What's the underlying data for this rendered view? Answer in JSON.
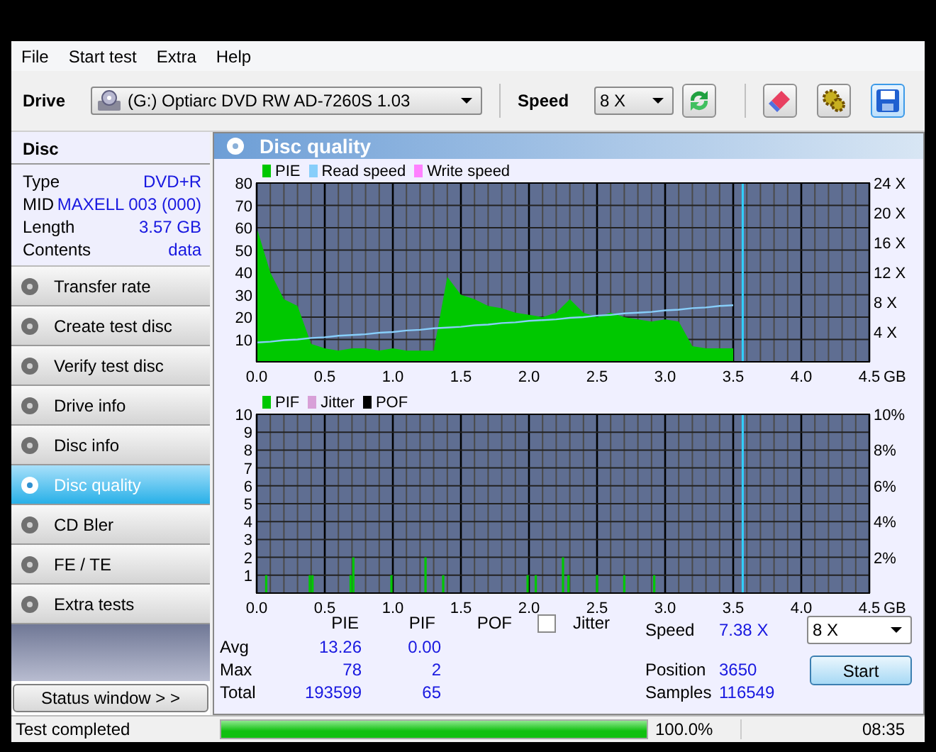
{
  "menu": [
    "File",
    "Start test",
    "Extra",
    "Help"
  ],
  "toolbar": {
    "drive_label": "Drive",
    "drive": "(G:)   Optiarc DVD RW AD-7260S 1.03",
    "speed_label": "Speed",
    "speed": "8 X"
  },
  "disc": {
    "title": "Disc",
    "fields": [
      {
        "label": "Type",
        "value": "DVD+R"
      },
      {
        "label": "MID",
        "value": "MAXELL 003 (000)"
      },
      {
        "label": "Length",
        "value": "3.57 GB"
      },
      {
        "label": "Contents",
        "value": "data"
      }
    ]
  },
  "nav": [
    {
      "label": "Transfer rate",
      "selected": false
    },
    {
      "label": "Create test disc",
      "selected": false
    },
    {
      "label": "Verify test disc",
      "selected": false
    },
    {
      "label": "Drive info",
      "selected": false
    },
    {
      "label": "Disc info",
      "selected": false
    },
    {
      "label": "Disc quality",
      "selected": true
    },
    {
      "label": "CD Bler",
      "selected": false
    },
    {
      "label": "FE / TE",
      "selected": false
    },
    {
      "label": "Extra tests",
      "selected": false
    }
  ],
  "status_window_button": "Status window > >",
  "panel_title": "Disc quality",
  "charts": [
    {
      "legend_extra": [
        {
          "label": "Write speed",
          "color": "#ff80ff"
        }
      ],
      "chart_data": {
        "type": "area",
        "xlabel": "GB",
        "xlim": [
          0,
          4.5
        ],
        "ylim": [
          0,
          80
        ],
        "y2lim": [
          0,
          24
        ],
        "grid": true,
        "x": [
          0.0,
          0.1,
          0.2,
          0.3,
          0.4,
          0.5,
          0.6,
          0.7,
          0.8,
          0.9,
          1.0,
          1.1,
          1.2,
          1.3,
          1.4,
          1.5,
          1.6,
          1.7,
          1.8,
          1.9,
          2.0,
          2.1,
          2.2,
          2.3,
          2.4,
          2.5,
          2.6,
          2.7,
          2.8,
          2.9,
          3.0,
          3.1,
          3.2,
          3.3,
          3.4,
          3.5
        ],
        "series": [
          {
            "name": "PIE",
            "color": "#00c800",
            "values": [
              60,
              40,
              28,
              25,
              8,
              6,
              5,
              6,
              6,
              5,
              6,
              5,
              5,
              5,
              38,
              30,
              28,
              25,
              24,
              22,
              21,
              20,
              22,
              28,
              22,
              20,
              22,
              20,
              19,
              18,
              19,
              18,
              7,
              6,
              6,
              6
            ]
          },
          {
            "name": "Read speed",
            "color": "#87cefa",
            "type": "line",
            "axis": "y2",
            "values": [
              2.6,
              2.7,
              2.9,
              3.0,
              3.2,
              3.3,
              3.5,
              3.6,
              3.7,
              3.9,
              4.0,
              4.2,
              4.3,
              4.5,
              4.6,
              4.7,
              4.9,
              5.0,
              5.2,
              5.3,
              5.5,
              5.6,
              5.7,
              5.9,
              6.0,
              6.2,
              6.3,
              6.5,
              6.6,
              6.7,
              6.9,
              7.0,
              7.2,
              7.3,
              7.5,
              7.6
            ]
          }
        ],
        "ref_lines": [
          {
            "axis": "x",
            "value": 3.57,
            "color": "#30d0ff"
          }
        ],
        "xticks": [
          {
            "value": 0,
            "label": "0.0"
          },
          {
            "value": 0.5,
            "label": "0.5"
          },
          {
            "value": 1,
            "label": "1.0"
          },
          {
            "value": 1.5,
            "label": "1.5"
          },
          {
            "value": 2,
            "label": "2.0"
          },
          {
            "value": 2.5,
            "label": "2.5"
          },
          {
            "value": 3,
            "label": "3.0"
          },
          {
            "value": 3.5,
            "label": "3.5"
          },
          {
            "value": 4,
            "label": "4.0"
          },
          {
            "value": 4.5,
            "label": "4.5"
          }
        ],
        "yticks": [
          10,
          20,
          30,
          40,
          50,
          60,
          70,
          80
        ],
        "y2ticks": [
          {
            "value": 4,
            "label": "4 X"
          },
          {
            "value": 8,
            "label": "8 X"
          },
          {
            "value": 12,
            "label": "12 X"
          },
          {
            "value": 16,
            "label": "16 X"
          },
          {
            "value": 20,
            "label": "20 X"
          },
          {
            "value": 24,
            "label": "24 X"
          }
        ]
      }
    },
    {
      "legend_extra": [
        {
          "label": "Jitter",
          "color": "#d8a0d8"
        },
        {
          "label": "POF",
          "color": "#000000"
        }
      ],
      "chart_data": {
        "type": "bar",
        "xlabel": "GB",
        "xlim": [
          0,
          4.5
        ],
        "ylim": [
          0,
          10
        ],
        "y2lim": [
          0,
          10
        ],
        "grid": true,
        "x": [
          0.07,
          0.39,
          0.41,
          0.69,
          0.71,
          0.99,
          1.24,
          1.37,
          1.99,
          2.05,
          2.25,
          2.29,
          2.5,
          2.7,
          2.92
        ],
        "series": [
          {
            "name": "PIF",
            "color": "#00c800",
            "values": [
              1,
              1,
              1,
              1,
              2,
              1,
              2,
              1,
              1,
              1,
              2,
              1,
              1,
              1,
              1
            ]
          }
        ],
        "ref_lines": [
          {
            "axis": "x",
            "value": 3.57,
            "color": "#30d0ff"
          }
        ],
        "xticks": [
          {
            "value": 0,
            "label": "0.0"
          },
          {
            "value": 0.5,
            "label": "0.5"
          },
          {
            "value": 1,
            "label": "1.0"
          },
          {
            "value": 1.5,
            "label": "1.5"
          },
          {
            "value": 2,
            "label": "2.0"
          },
          {
            "value": 2.5,
            "label": "2.5"
          },
          {
            "value": 3,
            "label": "3.0"
          },
          {
            "value": 3.5,
            "label": "3.5"
          },
          {
            "value": 4,
            "label": "4.0"
          },
          {
            "value": 4.5,
            "label": "4.5"
          }
        ],
        "yticks": [
          1,
          2,
          3,
          4,
          5,
          6,
          7,
          8,
          9,
          10
        ],
        "y2ticks": [
          {
            "value": 2,
            "label": "2%"
          },
          {
            "value": 4,
            "label": "4%"
          },
          {
            "value": 6,
            "label": "6%"
          },
          {
            "value": 8,
            "label": "8%"
          },
          {
            "value": 10,
            "label": "10%"
          }
        ]
      }
    }
  ],
  "stats": {
    "headers": [
      "PIE",
      "PIF",
      "POF"
    ],
    "jitter": {
      "label": "Jitter",
      "checked": false
    },
    "rows": [
      {
        "label": "Avg",
        "values": [
          "13.26",
          "0.00"
        ]
      },
      {
        "label": "Max",
        "values": [
          "78",
          "2"
        ]
      },
      {
        "label": "Total",
        "values": [
          "193599",
          "65"
        ]
      }
    ]
  },
  "readings": [
    {
      "label": "Speed",
      "value": "7.38 X"
    },
    {
      "label": "Position",
      "value": "3650"
    },
    {
      "label": "Samples",
      "value": "116549"
    }
  ],
  "speed_select": "8 X",
  "start_button": "Start",
  "status_bar": {
    "text": "Test completed",
    "level": 1.0,
    "percent": "100.0%",
    "time": "08:35"
  }
}
